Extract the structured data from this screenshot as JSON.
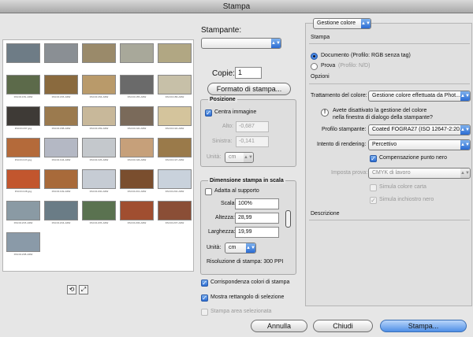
{
  "window": {
    "title": "Stampa"
  },
  "preview": {
    "thumbnails": [
      {
        "caption": "",
        "color": "#6e7c86"
      },
      {
        "caption": "",
        "color": "#8a8f94"
      },
      {
        "caption": "",
        "color": "#9a8a6a"
      },
      {
        "caption": "",
        "color": "#a8a89a"
      },
      {
        "caption": "",
        "color": "#b1a783"
      },
      {
        "caption": "DSC01181.ARW",
        "color": "#5c6a4a"
      },
      {
        "caption": "DSC01183.ARW",
        "color": "#8a6a3e"
      },
      {
        "caption": "DSC01184.ARW",
        "color": "#b99a6a"
      },
      {
        "caption": "DSC01185.ARW",
        "color": "#6a6a6a"
      },
      {
        "caption": "DSC01186.ARW",
        "color": "#c7c0a8"
      },
      {
        "caption": "DSC01187.jpg",
        "color": "#3e3a36"
      },
      {
        "caption": "DSC01188.ARW",
        "color": "#9b7a4e"
      },
      {
        "caption": "DSC01189.ARW",
        "color": "#c8b89a"
      },
      {
        "caption": "DSC01190.ARW",
        "color": "#7a6a5a"
      },
      {
        "caption": "DSC01192.ARW",
        "color": "#d4c49c"
      },
      {
        "caption": "DSC01193.jpg",
        "color": "#b46a3a"
      },
      {
        "caption": "DSC01194.ARW",
        "color": "#b4b8c4"
      },
      {
        "caption": "DSC01195.ARW",
        "color": "#c4c8cc"
      },
      {
        "caption": "DSC01196.ARW",
        "color": "#c6a07a"
      },
      {
        "caption": "DSC01197.ARW",
        "color": "#9a7a4a"
      },
      {
        "caption": "DSC01198.jpg",
        "color": "#c2562e"
      },
      {
        "caption": "DSC01199.ARW",
        "color": "#a86a3a"
      },
      {
        "caption": "DSC01200.ARW",
        "color": "#c6ccd4"
      },
      {
        "caption": "DSC01201.ARW",
        "color": "#7a4e2e"
      },
      {
        "caption": "DSC01202.ARW",
        "color": "#c9d2dc"
      },
      {
        "caption": "DSC01203.ARW",
        "color": "#8a9aa4"
      },
      {
        "caption": "DSC01204.ARW",
        "color": "#6a7c86"
      },
      {
        "caption": "DSC01205.ARW",
        "color": "#5a7250"
      },
      {
        "caption": "DSC01206.ARW",
        "color": "#a04e30"
      },
      {
        "caption": "DSC01207.ARW",
        "color": "#8a4e36"
      },
      {
        "caption": "DSC01208.ARW",
        "color": "#8a9aa8"
      }
    ],
    "view_buttons": [
      "reset-view-icon",
      "fit-view-icon"
    ]
  },
  "printer": {
    "label": "Stampante:",
    "value": "",
    "copies_label": "Copie:",
    "copies": "1",
    "page_setup_button": "Formato di stampa..."
  },
  "position": {
    "title": "Posizione",
    "center_label": "Centra immagine",
    "center_checked": true,
    "top_label": "Alto:",
    "top_value": "-0,687",
    "left_label": "Sinistra:",
    "left_value": "-0,141",
    "units_label": "Unità:",
    "units_value": "cm"
  },
  "scaled_print": {
    "title": "Dimensione stampa in scala",
    "fit_label": "Adatta al supporto",
    "fit_checked": false,
    "scale_label": "Scala:",
    "scale_value": "100%",
    "height_label": "Altezza:",
    "height_value": "28,99",
    "width_label": "Larghezza:",
    "width_value": "19,99",
    "units_label": "Unità:",
    "units_value": "cm",
    "resolution_text": "Risoluzione di stampa: 300 PPI"
  },
  "bottom_options": {
    "match_colors_label": "Corrispondenza colori di stampa",
    "match_colors_checked": true,
    "show_bbox_label": "Mostra rettangolo di selezione",
    "show_bbox_checked": true,
    "print_selected_label": "Stampa area selezionata",
    "print_selected_checked": false
  },
  "color_management": {
    "section_popup": "Gestione colore",
    "print_heading": "Stampa",
    "document_label": "Documento",
    "document_profile": "(Profilo: RGB senza tag)",
    "proof_label": "Prova",
    "proof_profile": "(Profilo: N/D)",
    "options_heading": "Opzioni",
    "color_handling_label": "Trattamento del colore:",
    "color_handling_value": "Gestione colore effettuata da Phot...",
    "warning_text_1": "Avete disattivato la gestione del colore",
    "warning_text_2": "nella finestra di dialogo della stampante?",
    "printer_profile_label": "Profilo stampante:",
    "printer_profile_value": "Coated FOGRA27 (ISO 12647-2:20...",
    "rendering_intent_label": "Intento di rendering:",
    "rendering_intent_value": "Percettivo",
    "black_point_label": "Compensazione punto nero",
    "black_point_checked": true,
    "proof_setup_label": "Imposta prova:",
    "proof_setup_value": "CMYK di lavoro",
    "simulate_paper_label": "Simula colore carta",
    "simulate_paper_checked": false,
    "simulate_black_label": "Simula inchiostro nero",
    "simulate_black_checked": true,
    "description_heading": "Descrizione"
  },
  "footer": {
    "cancel_label": "Annulla",
    "done_label": "Chiudi",
    "print_label": "Stampa..."
  },
  "colors": {
    "accent": "#2a6bd2",
    "dialog_bg": "#e6e6e6"
  }
}
